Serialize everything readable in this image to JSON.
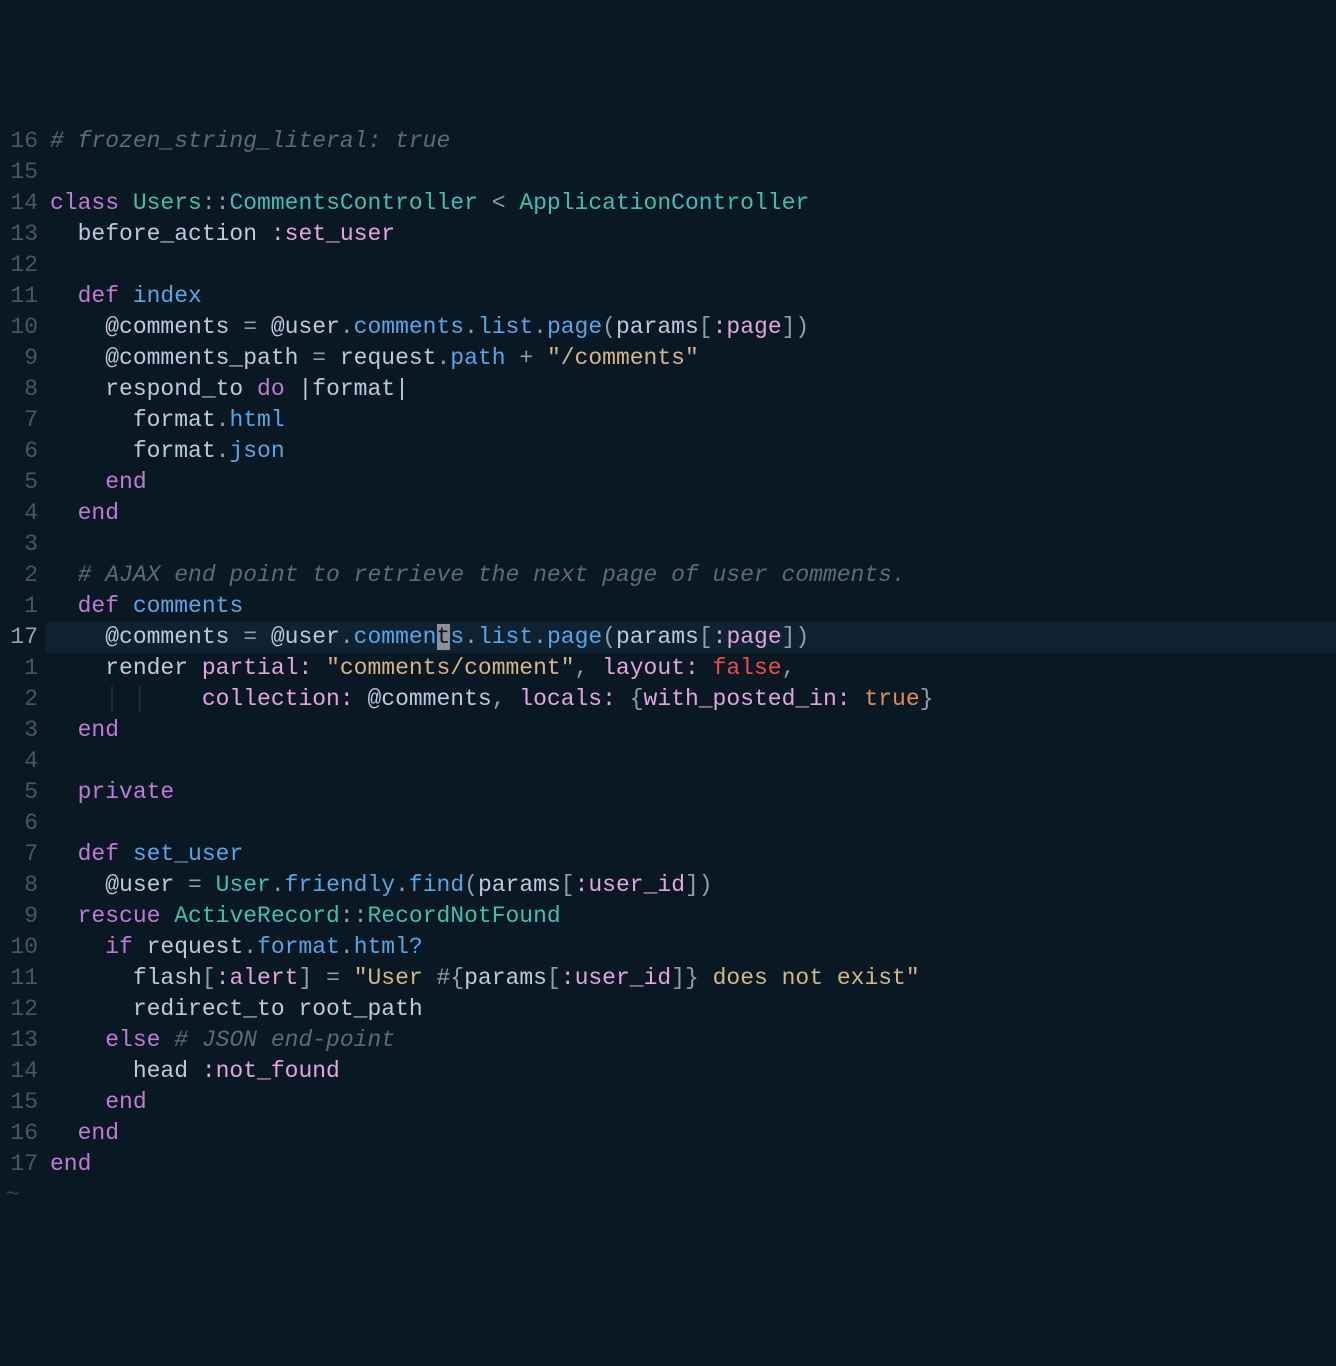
{
  "colors": {
    "bg": "#0a1824",
    "gutter": "#465764",
    "gutterActive": "#8fa3b5",
    "cursorBg": "#8a9199",
    "comment": "#5c6b78",
    "keyword": "#c07ad6",
    "className": "#3fbfb0",
    "method": "#57a5e5",
    "identifier": "#bfc9db",
    "symbol": "#e2a5de",
    "string": "#d3b58a",
    "operator": "#8aa0ab",
    "false": "#ec4c4c",
    "true": "#de8f59"
  },
  "cursorLineIndex": 16,
  "lines": [
    {
      "rel": "16",
      "tokens": [
        [
          "cm",
          "# frozen_string_literal: true"
        ]
      ]
    },
    {
      "rel": "15",
      "tokens": []
    },
    {
      "rel": "14",
      "tokens": [
        [
          "kw",
          "class "
        ],
        [
          "cn",
          "Users"
        ],
        [
          "op",
          "::"
        ],
        [
          "cn",
          "CommentsController"
        ],
        [
          "op",
          " < "
        ],
        [
          "cn",
          "ApplicationController"
        ]
      ]
    },
    {
      "rel": "13",
      "tokens": [
        [
          "id",
          "  before_action "
        ],
        [
          "sy",
          ":set_user"
        ]
      ]
    },
    {
      "rel": "12",
      "tokens": []
    },
    {
      "rel": "11",
      "tokens": [
        [
          "kw",
          "  def "
        ],
        [
          "fn",
          "index"
        ]
      ]
    },
    {
      "rel": "10",
      "tokens": [
        [
          "id",
          "    @comments "
        ],
        [
          "op",
          "= "
        ],
        [
          "id",
          "@user"
        ],
        [
          "op",
          "."
        ],
        [
          "fn",
          "comments"
        ],
        [
          "op",
          "."
        ],
        [
          "fn",
          "list"
        ],
        [
          "op",
          "."
        ],
        [
          "fn",
          "page"
        ],
        [
          "op",
          "("
        ],
        [
          "id",
          "params"
        ],
        [
          "op",
          "["
        ],
        [
          "sy",
          ":page"
        ],
        [
          "op",
          "])"
        ]
      ]
    },
    {
      "rel": "9",
      "tokens": [
        [
          "id",
          "    @comments_path "
        ],
        [
          "op",
          "= "
        ],
        [
          "id",
          "request"
        ],
        [
          "op",
          "."
        ],
        [
          "fn",
          "path"
        ],
        [
          "op",
          " + "
        ],
        [
          "st",
          "\"/comments\""
        ]
      ]
    },
    {
      "rel": "8",
      "tokens": [
        [
          "id",
          "    respond_to "
        ],
        [
          "kw",
          "do"
        ],
        [
          "id",
          " |"
        ],
        [
          "id",
          "format"
        ],
        [
          "id",
          "|"
        ]
      ]
    },
    {
      "rel": "7",
      "tokens": [
        [
          "id",
          "      format"
        ],
        [
          "op",
          "."
        ],
        [
          "fn",
          "html"
        ]
      ]
    },
    {
      "rel": "6",
      "tokens": [
        [
          "id",
          "      format"
        ],
        [
          "op",
          "."
        ],
        [
          "fn",
          "json"
        ]
      ]
    },
    {
      "rel": "5",
      "tokens": [
        [
          "kw",
          "    end"
        ]
      ]
    },
    {
      "rel": "4",
      "tokens": [
        [
          "kw",
          "  end"
        ]
      ]
    },
    {
      "rel": "3",
      "tokens": []
    },
    {
      "rel": "2",
      "tokens": [
        [
          "cm",
          "  # AJAX end point to retrieve the next page of user comments."
        ]
      ]
    },
    {
      "rel": "1",
      "tokens": [
        [
          "kw",
          "  def "
        ],
        [
          "fn",
          "comments"
        ]
      ]
    },
    {
      "rel": "17",
      "cursor": true,
      "tokens": [
        [
          "id",
          "    @comments "
        ],
        [
          "op",
          "= "
        ],
        [
          "id",
          "@user"
        ],
        [
          "op",
          "."
        ],
        [
          "fn",
          "commen"
        ],
        [
          "cur",
          "t"
        ],
        [
          "fn",
          "s"
        ],
        [
          "op",
          "."
        ],
        [
          "fn",
          "list"
        ],
        [
          "op",
          "."
        ],
        [
          "fn",
          "page"
        ],
        [
          "op",
          "("
        ],
        [
          "id",
          "params"
        ],
        [
          "op",
          "["
        ],
        [
          "sy",
          ":page"
        ],
        [
          "op",
          "])"
        ]
      ]
    },
    {
      "rel": "1",
      "tokens": [
        [
          "id",
          "    render "
        ],
        [
          "sy",
          "partial:"
        ],
        [
          "id",
          " "
        ],
        [
          "st",
          "\"comments/comment\""
        ],
        [
          "op",
          ", "
        ],
        [
          "sy",
          "layout:"
        ],
        [
          "id",
          " "
        ],
        [
          "bf",
          "false"
        ],
        [
          "op",
          ","
        ]
      ]
    },
    {
      "rel": "2",
      "tokens": [
        [
          "guide",
          "    │ │    "
        ],
        [
          "sy",
          "collection:"
        ],
        [
          "id",
          " @comments"
        ],
        [
          "op",
          ", "
        ],
        [
          "sy",
          "locals:"
        ],
        [
          "id",
          " "
        ],
        [
          "op",
          "{"
        ],
        [
          "sy",
          "with_posted_in:"
        ],
        [
          "id",
          " "
        ],
        [
          "bt",
          "true"
        ],
        [
          "op",
          "}"
        ]
      ]
    },
    {
      "rel": "3",
      "tokens": [
        [
          "kw",
          "  end"
        ]
      ]
    },
    {
      "rel": "4",
      "tokens": []
    },
    {
      "rel": "5",
      "tokens": [
        [
          "pr",
          "  private"
        ]
      ]
    },
    {
      "rel": "6",
      "tokens": []
    },
    {
      "rel": "7",
      "tokens": [
        [
          "kw",
          "  def "
        ],
        [
          "fn",
          "set_user"
        ]
      ]
    },
    {
      "rel": "8",
      "tokens": [
        [
          "id",
          "    @user "
        ],
        [
          "op",
          "= "
        ],
        [
          "cn",
          "User"
        ],
        [
          "op",
          "."
        ],
        [
          "fn",
          "friendly"
        ],
        [
          "op",
          "."
        ],
        [
          "fn",
          "find"
        ],
        [
          "op",
          "("
        ],
        [
          "id",
          "params"
        ],
        [
          "op",
          "["
        ],
        [
          "sy",
          ":user_id"
        ],
        [
          "op",
          "])"
        ]
      ]
    },
    {
      "rel": "9",
      "tokens": [
        [
          "kw",
          "  rescue "
        ],
        [
          "cn",
          "ActiveRecord"
        ],
        [
          "op",
          "::"
        ],
        [
          "cn",
          "RecordNotFound"
        ]
      ]
    },
    {
      "rel": "10",
      "tokens": [
        [
          "kw",
          "    if "
        ],
        [
          "id",
          "request"
        ],
        [
          "op",
          "."
        ],
        [
          "fn",
          "format"
        ],
        [
          "op",
          "."
        ],
        [
          "fn",
          "html?"
        ]
      ]
    },
    {
      "rel": "11",
      "tokens": [
        [
          "id",
          "      flash"
        ],
        [
          "op",
          "["
        ],
        [
          "sy",
          ":alert"
        ],
        [
          "op",
          "] = "
        ],
        [
          "st",
          "\"User "
        ],
        [
          "op",
          "#{"
        ],
        [
          "id",
          "params"
        ],
        [
          "op",
          "["
        ],
        [
          "sy",
          ":user_id"
        ],
        [
          "op",
          "]"
        ],
        [
          "op",
          "}"
        ],
        [
          "st",
          " does not exist\""
        ]
      ]
    },
    {
      "rel": "12",
      "tokens": [
        [
          "id",
          "      redirect_to "
        ],
        [
          "id",
          "root_path"
        ]
      ]
    },
    {
      "rel": "13",
      "tokens": [
        [
          "kw",
          "    else "
        ],
        [
          "cm",
          "# JSON end-point"
        ]
      ]
    },
    {
      "rel": "14",
      "tokens": [
        [
          "id",
          "      head "
        ],
        [
          "sy",
          ":not_found"
        ]
      ]
    },
    {
      "rel": "15",
      "tokens": [
        [
          "kw",
          "    end"
        ]
      ]
    },
    {
      "rel": "16",
      "tokens": [
        [
          "kw",
          "  end"
        ]
      ]
    },
    {
      "rel": "17",
      "tokens": [
        [
          "kw",
          "end"
        ]
      ]
    }
  ],
  "filler": "~"
}
